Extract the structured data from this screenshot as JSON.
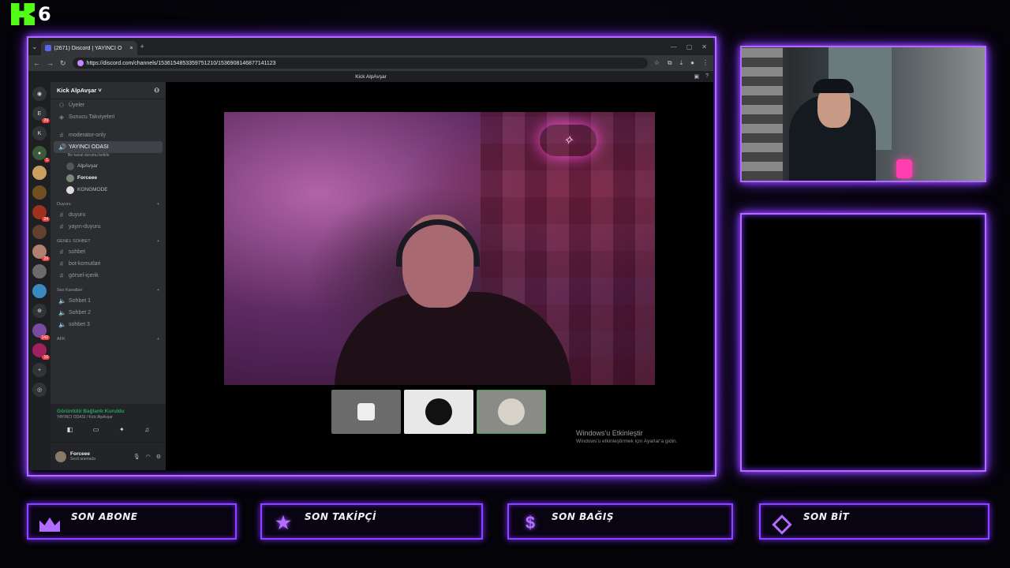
{
  "logo": {
    "letter": "K",
    "number": "6"
  },
  "browser": {
    "tab_title": "(2671) Discord | YAYINCI O",
    "url": "https://discord.com/channels/1536154853359751210/1536908146877141123",
    "page_title": "Kick AlpAvşar"
  },
  "discord": {
    "guild_name": "Kick AlpAvşar ˅",
    "top_items": [
      "Üyeler",
      "Sunucu Takviyeleri"
    ],
    "channels_top": [
      {
        "name": "moderator-only"
      }
    ],
    "voice_active": {
      "name": "YAYINCI ODASI",
      "note": "Bir kanal durumu belirle",
      "members": [
        "AlpAvşar",
        "Forceee",
        "KONGMODE"
      ]
    },
    "categories": [
      {
        "name": "Duyuru",
        "channels": [
          "duyuru",
          "yayın-duyuru"
        ]
      },
      {
        "name": "GENEL SOHBET",
        "channels": [
          "sohbet",
          "bot-komutlari",
          "görsel-içerik"
        ]
      },
      {
        "name": "Ses Kanalları",
        "channels": [
          "Sohbet 1",
          "Sohbet 2",
          "sohbet 3"
        ]
      },
      {
        "name": "AFK",
        "channels": []
      }
    ],
    "voice_connection": {
      "title": "Görüntülü Bağlantı Kuruldu",
      "sub": "YAYINCI ODASI / Kick AlpAvşar"
    },
    "user": {
      "name": "Forceee",
      "status": "Sesli aramada"
    },
    "server_badges": [
      "29",
      "1",
      "24",
      "29",
      "142",
      "16"
    ]
  },
  "windows_activation": {
    "title": "Windows'u Etkinleştir",
    "subtitle": "Windows'u etkinleştirmek için Ayarlar'a gidin."
  },
  "overlay_labels": [
    "SON ABONE",
    "SON TAKİPÇİ",
    "SON BAĞIŞ",
    "SON BİT"
  ],
  "colors": {
    "neon": "#b46bff",
    "kick_green": "#53fc18",
    "discord_blurple": "#5865f2"
  }
}
